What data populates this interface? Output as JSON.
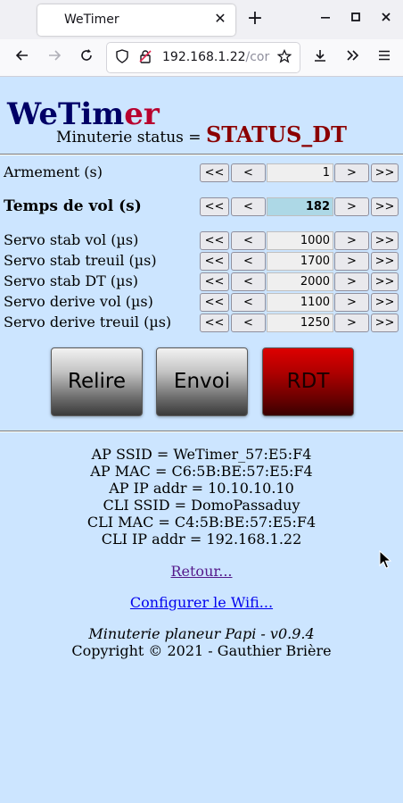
{
  "browser": {
    "tab_title": "WeTimer",
    "url_host": "192.168.1.22",
    "url_path": "/cor"
  },
  "page": {
    "logo": "WeTimer",
    "status_label": "Minuterie status =",
    "status_value": "STATUS_DT",
    "params": [
      {
        "label": "Armement (s)",
        "value": "1",
        "bold": false,
        "highlight": false
      },
      {
        "label": "Temps de vol (s)",
        "value": "182",
        "bold": true,
        "highlight": true
      },
      {
        "label": "Servo stab vol (µs)",
        "value": "1000",
        "bold": false,
        "highlight": false
      },
      {
        "label": "Servo stab treuil (µs)",
        "value": "1700",
        "bold": false,
        "highlight": false
      },
      {
        "label": "Servo stab DT (µs)",
        "value": "2000",
        "bold": false,
        "highlight": false
      },
      {
        "label": "Servo derive vol (µs)",
        "value": "1100",
        "bold": false,
        "highlight": false
      },
      {
        "label": "Servo derive treuil (µs)",
        "value": "1250",
        "bold": false,
        "highlight": false
      }
    ],
    "step_buttons": {
      "fast_down": "<<",
      "down": "<",
      "up": ">",
      "fast_up": ">>"
    },
    "actions": {
      "reload": "Relire",
      "send": "Envoi",
      "rdt": "RDT"
    },
    "info_lines": [
      "AP SSID = WeTimer_57:E5:F4",
      "AP MAC = C6:5B:BE:57:E5:F4",
      "AP IP addr = 10.10.10.10",
      "CLI SSID = DomoPassaduy",
      "CLI MAC = C4:5B:BE:57:E5:F4",
      "CLI IP addr = 192.168.1.22"
    ],
    "back_link": "Retour...",
    "wifi_link": "Configurer le Wifi...",
    "footer_title": "Minuterie planeur Papi - v0.9.4",
    "footer_copyright": "Copyright © 2021 - Gauthier Brière"
  },
  "colors": {
    "page_bg": "#cce5ff",
    "logo_navy": "#000066",
    "logo_red": "#b8002e",
    "status_red": "#8b0000",
    "highlight_input": "#add8e6",
    "rdt_red": "#b00000"
  },
  "icons": [
    "close-icon",
    "plus-icon",
    "minimize-icon",
    "maximize-icon",
    "back-arrow-icon",
    "forward-arrow-icon",
    "reload-icon",
    "shield-icon",
    "insecure-lock-icon",
    "star-icon",
    "download-icon",
    "overflow-chevron-icon",
    "hamburger-menu-icon",
    "mouse-cursor-icon"
  ]
}
